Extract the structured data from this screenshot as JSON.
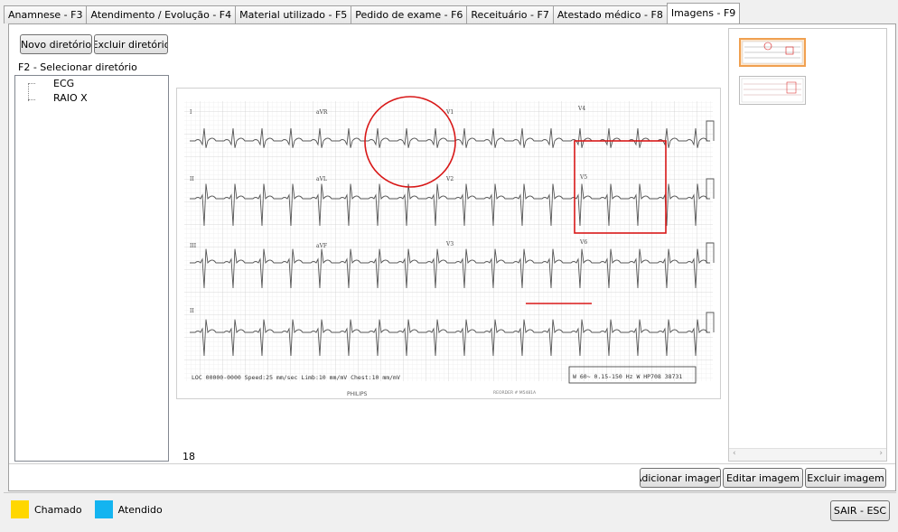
{
  "tabs": [
    {
      "id": "anamnese",
      "label": "Anamnese - F3",
      "active": false
    },
    {
      "id": "atendimento",
      "label": "Atendimento / Evolução - F4",
      "active": false
    },
    {
      "id": "material",
      "label": "Material utilizado - F5",
      "active": false
    },
    {
      "id": "pedido",
      "label": "Pedido de exame - F6",
      "active": false
    },
    {
      "id": "receituario",
      "label": "Receituário - F7",
      "active": false
    },
    {
      "id": "atestado",
      "label": "Atestado médico - F8",
      "active": false
    },
    {
      "id": "imagens",
      "label": "Imagens - F9",
      "active": true
    }
  ],
  "left_panel": {
    "new_dir_label": "Novo diretório",
    "delete_dir_label": "Excluir diretório",
    "select_dir_label": "F2 - Selecionar diretório",
    "tree_items": [
      "ECG",
      "RAIO X"
    ]
  },
  "viewer": {
    "image_count": "18",
    "ecg": {
      "lead_labels": [
        "I",
        "aVR",
        "V1",
        "V4",
        "II",
        "aVL",
        "V2",
        "V5",
        "III",
        "aVF",
        "V3",
        "V6",
        "II"
      ],
      "footer_left": "LOC 00000-0000    Speed:25 mm/sec    Limb:10 mm/mV    Chest:10 mm/mV",
      "footer_right": "W 60~ 0.15-150 Hz W    HP708    38731",
      "brand": "PHILIPS",
      "recorder": "REORDER # M5481A"
    }
  },
  "actions": {
    "add_image": "Adicionar imagem",
    "edit_image": "Editar imagem",
    "delete_image": "Excluir imagem"
  },
  "legend": {
    "items": [
      {
        "label": "Chamado",
        "color": "#ffd700"
      },
      {
        "label": "Atendido",
        "color": "#14b4f0"
      }
    ]
  },
  "exit_label": "SAIR - ESC",
  "colors": {
    "annotation_red": "#d81818",
    "thumb_selected": "#f0a050"
  }
}
